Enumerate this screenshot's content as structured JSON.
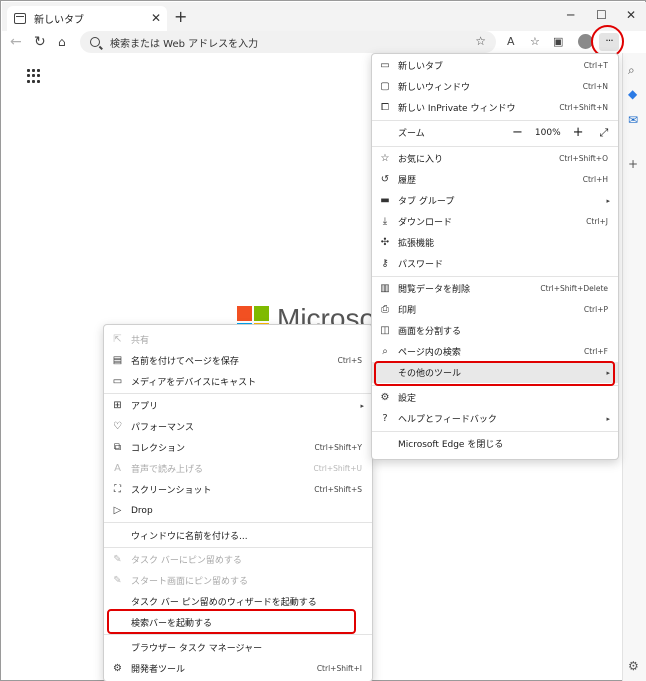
{
  "tab": {
    "title": "新しいタブ"
  },
  "address_bar": {
    "placeholder": "検索または Web アドレスを入力"
  },
  "brand": {
    "name": "Microsoft"
  },
  "main_menu": {
    "items": [
      {
        "icon": "new-tab-icon",
        "label": "新しいタブ",
        "shortcut": "Ctrl+T"
      },
      {
        "icon": "new-window-icon",
        "label": "新しいウィンドウ",
        "shortcut": "Ctrl+N"
      },
      {
        "icon": "inprivate-icon",
        "label": "新しい InPrivate ウィンドウ",
        "shortcut": "Ctrl+Shift+N"
      },
      {
        "icon": "",
        "label": "ズーム",
        "zoom_value": "100%"
      },
      {
        "icon": "favorites-icon",
        "label": "お気に入り",
        "shortcut": "Ctrl+Shift+O"
      },
      {
        "icon": "history-icon",
        "label": "履歴",
        "shortcut": "Ctrl+H"
      },
      {
        "icon": "tab-group-icon",
        "label": "タブ グループ",
        "submenu": true
      },
      {
        "icon": "download-icon",
        "label": "ダウンロード",
        "shortcut": "Ctrl+J"
      },
      {
        "icon": "extensions-icon",
        "label": "拡張機能"
      },
      {
        "icon": "password-icon",
        "label": "パスワード"
      },
      {
        "icon": "delete-data-icon",
        "label": "閲覧データを削除",
        "shortcut": "Ctrl+Shift+Delete"
      },
      {
        "icon": "print-icon",
        "label": "印刷",
        "shortcut": "Ctrl+P"
      },
      {
        "icon": "split-screen-icon",
        "label": "画面を分割する"
      },
      {
        "icon": "find-icon",
        "label": "ページ内の検索",
        "shortcut": "Ctrl+F"
      },
      {
        "icon": "",
        "label": "その他のツール",
        "submenu": true
      },
      {
        "icon": "settings-icon",
        "label": "設定"
      },
      {
        "icon": "help-icon",
        "label": "ヘルプとフィードバック",
        "submenu": true
      },
      {
        "icon": "",
        "label": "Microsoft Edge を閉じる"
      }
    ]
  },
  "sub_menu": {
    "items": [
      {
        "icon": "share-icon",
        "label": "共有",
        "disabled": true
      },
      {
        "icon": "save-page-icon",
        "label": "名前を付けてページを保存",
        "shortcut": "Ctrl+S"
      },
      {
        "icon": "cast-icon",
        "label": "メディアをデバイスにキャスト"
      },
      {
        "icon": "apps-icon",
        "label": "アプリ",
        "submenu": true
      },
      {
        "icon": "performance-icon",
        "label": "パフォーマンス"
      },
      {
        "icon": "collections-icon",
        "label": "コレクション",
        "shortcut": "Ctrl+Shift+Y"
      },
      {
        "icon": "read-aloud-icon",
        "label": "音声で読み上げる",
        "shortcut": "Ctrl+Shift+U",
        "disabled": true
      },
      {
        "icon": "screenshot-icon",
        "label": "スクリーンショット",
        "shortcut": "Ctrl+Shift+S"
      },
      {
        "icon": "drop-icon",
        "label": "Drop"
      },
      {
        "icon": "",
        "label": "ウィンドウに名前を付ける..."
      },
      {
        "icon": "pin-icon",
        "label": "タスク バーにピン留めする",
        "disabled": true
      },
      {
        "icon": "pin-icon",
        "label": "スタート画面にピン留めする",
        "disabled": true
      },
      {
        "icon": "",
        "label": "タスク バー ピン留めのウィザードを起動する"
      },
      {
        "icon": "",
        "label": "検索バーを起動する"
      },
      {
        "icon": "",
        "label": "ブラウザー タスク マネージャー"
      },
      {
        "icon": "devtools-icon",
        "label": "開発者ツール",
        "shortcut": "Ctrl+Shift+I"
      }
    ]
  },
  "colors": {
    "highlight": "#e00000",
    "ms_red": "#f25022",
    "ms_green": "#7fba00",
    "ms_blue": "#00a4ef",
    "ms_yellow": "#ffb900"
  }
}
